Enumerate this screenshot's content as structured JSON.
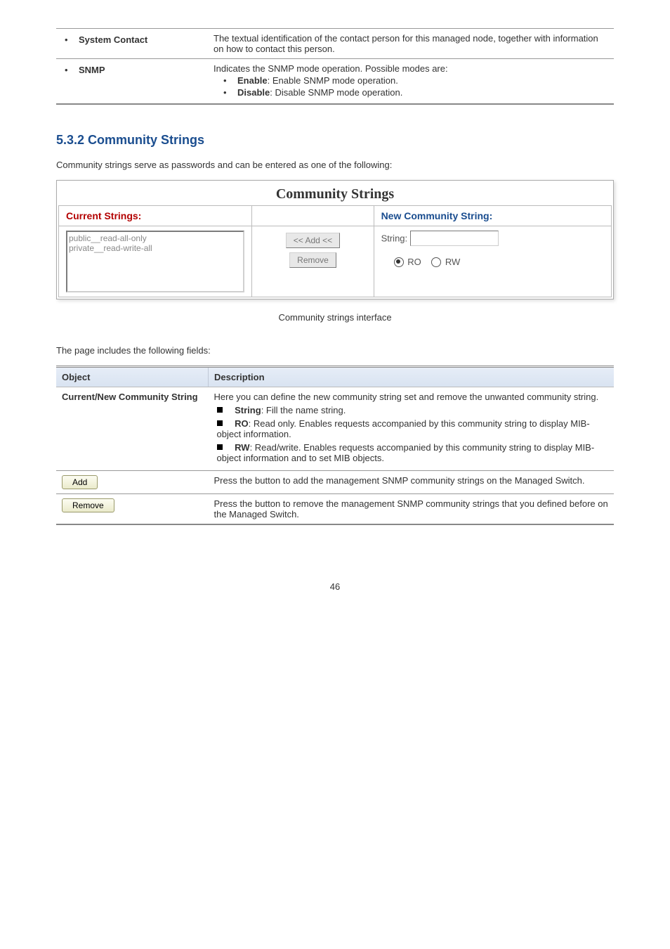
{
  "top_table": {
    "rows": [
      {
        "label_bullet": "•",
        "label": "System Contact",
        "desc": "The textual identification of the contact person for this managed node, together with information on how to contact this person."
      },
      {
        "label_bullet": "•",
        "label": "SNMP",
        "desc": "Indicates the SNMP mode operation. Possible modes are:",
        "sub": [
          {
            "b": "•",
            "k": "Enable",
            "t": ": Enable SNMP mode operation."
          },
          {
            "b": "•",
            "k": "Disable",
            "t": ": Disable SNMP mode operation."
          }
        ]
      }
    ]
  },
  "section_heading": "5.3.2 Community Strings",
  "intro": "Community strings serve as passwords and can be entered as one of the following:",
  "cs": {
    "title": "Community Strings",
    "left_header": "Current Strings:",
    "right_header": "New Community String:",
    "list": [
      "public__read-all-only",
      "private__read-write-all"
    ],
    "add_btn": "<< Add <<",
    "remove_btn": "Remove",
    "string_label": "String:",
    "ro": "RO",
    "rw": "RW"
  },
  "caption": "Community strings interface",
  "fields_intro": "The page includes the following fields:",
  "fields_table": {
    "head_left": "Object",
    "head_right": "Description",
    "rows": [
      {
        "label": "Current/New Community String",
        "desc_lead": "Here you can define the new community string set and remove the unwanted community string.",
        "items": [
          {
            "k": "String",
            "t": "Fill the name string."
          },
          {
            "k": "RO",
            "t": "Read only. Enables requests accompanied by this community string to display MIB-object information."
          },
          {
            "k": "RW",
            "t": "Read/write. Enables requests accompanied by this community string to display MIB-object information and to set MIB objects."
          }
        ]
      },
      {
        "btn": "Add",
        "desc": "Press the button to add the management SNMP community strings on the Managed Switch."
      },
      {
        "btn": "Remove",
        "desc": "Press the button to remove the management SNMP community strings that you defined before on the Managed Switch."
      }
    ]
  },
  "page_num": "46"
}
